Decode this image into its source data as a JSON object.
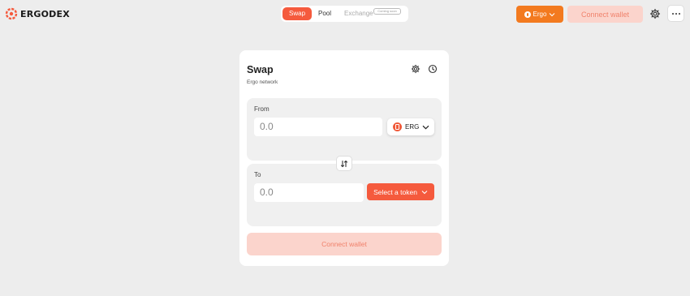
{
  "brand": {
    "name": "ERGODEX"
  },
  "nav": {
    "tabs": [
      {
        "label": "Swap",
        "active": true
      },
      {
        "label": "Pool",
        "active": false
      },
      {
        "label": "Exchange",
        "active": false,
        "disabled": true
      }
    ],
    "exchange_badge": "Coming soon"
  },
  "header": {
    "network_label": "Ergo",
    "connect_wallet_label": "Connect wallet",
    "settings_icon": "gear-icon",
    "more_icon": "ellipsis-icon"
  },
  "swap": {
    "title": "Swap",
    "subtitle": "Ergo network",
    "from": {
      "label": "From",
      "amount_placeholder": "0.0",
      "token": "ERG"
    },
    "to": {
      "label": "To",
      "amount_placeholder": "0.0",
      "select_token_label": "Select a token"
    },
    "connect_wallet_label": "Connect wallet"
  },
  "colors": {
    "accent": "#f55a3d",
    "network": "#f37a1f",
    "connect_bg": "#fbd4cc",
    "connect_text": "#f0826c",
    "background": "#ededed"
  }
}
